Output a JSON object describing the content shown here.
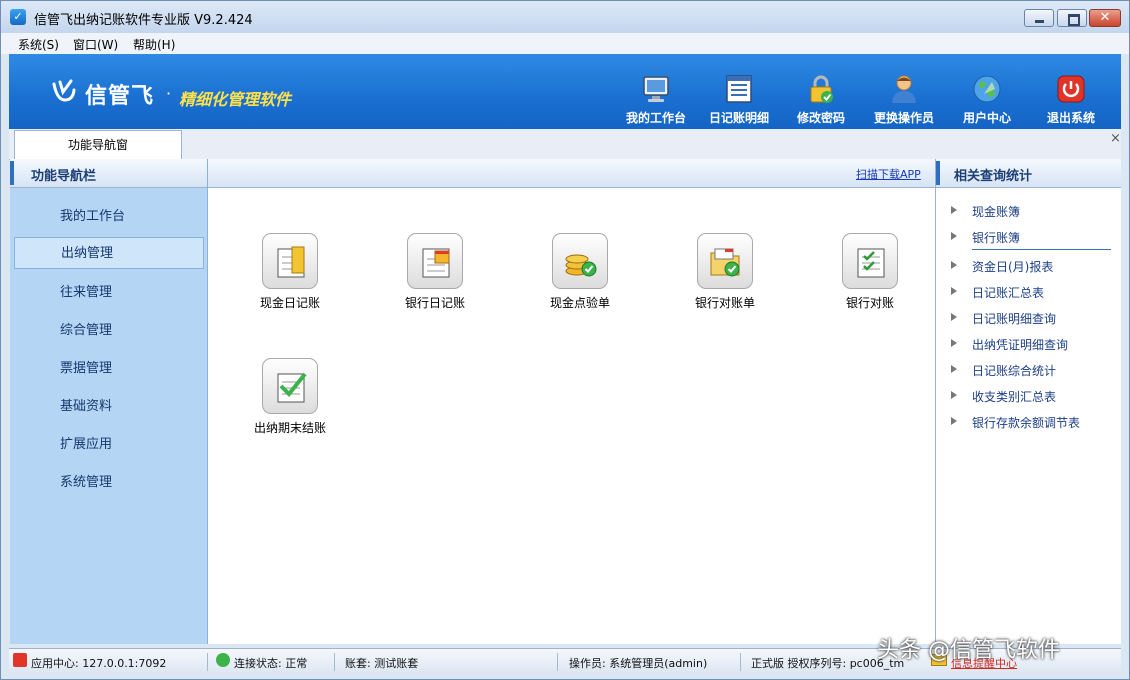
{
  "window": {
    "title": "信管飞出纳记账软件专业版 V9.2.424",
    "close_glyph": "✕"
  },
  "menu": [
    {
      "label": "系统(S)"
    },
    {
      "label": "窗口(W)"
    },
    {
      "label": "帮助(H)"
    }
  ],
  "banner": {
    "brand": "信管飞",
    "dot": "·",
    "slogan": "精细化管理软件",
    "tools": [
      {
        "label": "我的工作台",
        "icon": "monitor-icon"
      },
      {
        "label": "日记账明细",
        "icon": "ledger-detail-icon"
      },
      {
        "label": "修改密码",
        "icon": "lock-icon"
      },
      {
        "label": "更换操作员",
        "icon": "user-icon"
      },
      {
        "label": "用户中心",
        "icon": "globe-icon"
      },
      {
        "label": "退出系统",
        "icon": "power-icon"
      }
    ]
  },
  "tab": {
    "label": "功能导航窗",
    "close": "×"
  },
  "nav": {
    "title": "功能导航栏",
    "active_index": 1,
    "items": [
      {
        "label": "我的工作台"
      },
      {
        "label": "出纳管理"
      },
      {
        "label": "往来管理"
      },
      {
        "label": "综合管理"
      },
      {
        "label": "票据管理"
      },
      {
        "label": "基础资料"
      },
      {
        "label": "扩展应用"
      },
      {
        "label": "系统管理"
      }
    ]
  },
  "main": {
    "scan_link": "扫描下载APP",
    "features": [
      {
        "label": "现金日记账",
        "icon": "cash-journal-icon"
      },
      {
        "label": "银行日记账",
        "icon": "bank-journal-icon"
      },
      {
        "label": "现金点验单",
        "icon": "cash-check-icon"
      },
      {
        "label": "银行对账单",
        "icon": "bank-statement-icon"
      },
      {
        "label": "银行对账",
        "icon": "bank-reconcile-icon"
      },
      {
        "label": "出纳期末结账",
        "icon": "period-close-icon"
      }
    ]
  },
  "right": {
    "title": "相关查询统计",
    "links": [
      {
        "label": "现金账簿"
      },
      {
        "label": "银行账簿"
      },
      {
        "label": "资金日(月)报表"
      },
      {
        "label": "日记账汇总表"
      },
      {
        "label": "日记账明细查询"
      },
      {
        "label": "出纳凭证明细查询"
      },
      {
        "label": "日记账综合统计"
      },
      {
        "label": "收支类别汇总表"
      },
      {
        "label": "银行存款余额调节表"
      }
    ]
  },
  "status": {
    "app_center": "应用中心: 127.0.0.1:7092",
    "connection": "连接状态: 正常",
    "account_set": "账套: 测试账套",
    "operator": "操作员: 系统管理员(admin)",
    "license": "正式版 授权序列号: pc006_tm",
    "message": "信息提醒中心"
  },
  "watermark": "头条 @信管飞软件",
  "colors": {
    "banner": "#1a6fd0",
    "slogan": "#ffe14a",
    "nav_bg": "#b4d6f4"
  }
}
